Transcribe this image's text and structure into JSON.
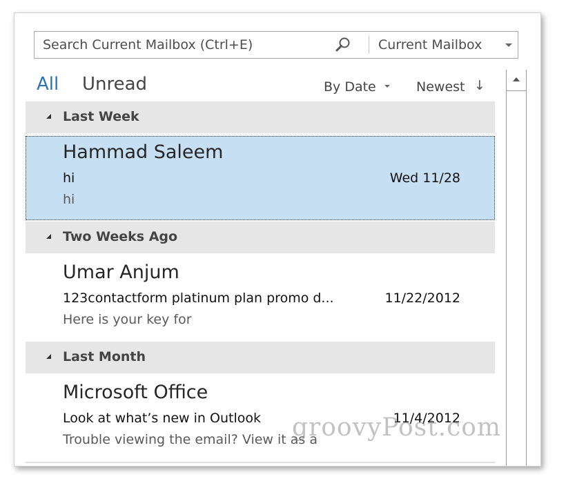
{
  "search": {
    "placeholder": "Search Current Mailbox (Ctrl+E)",
    "scope": "Current Mailbox",
    "icon": "search-icon"
  },
  "filters": {
    "all": "All",
    "unread": "Unread"
  },
  "sort": {
    "by": "By Date",
    "order": "Newest",
    "order_arrow": "↓"
  },
  "groups": [
    {
      "label": "Last Week",
      "items": [
        {
          "sender": "Hammad Saleem",
          "subject": "hi",
          "preview": "hi",
          "date": "Wed 11/28",
          "selected": true
        }
      ]
    },
    {
      "label": "Two Weeks Ago",
      "items": [
        {
          "sender": "Umar Anjum",
          "subject": "123contactform platinum plan promo d...",
          "preview": "Here is your key for",
          "date": "11/22/2012",
          "selected": false
        }
      ]
    },
    {
      "label": "Last Month",
      "items": [
        {
          "sender": "Microsoft Office",
          "subject": "Look at what’s new in Outlook",
          "preview": "Trouble viewing the email? View it as a",
          "date": "11/4/2012",
          "selected": false
        }
      ]
    }
  ],
  "watermark": "groovyPost.com",
  "colors": {
    "accent": "#2e73b5",
    "selected_bg": "#c6dff2",
    "group_header_bg": "#e6e6e6"
  }
}
